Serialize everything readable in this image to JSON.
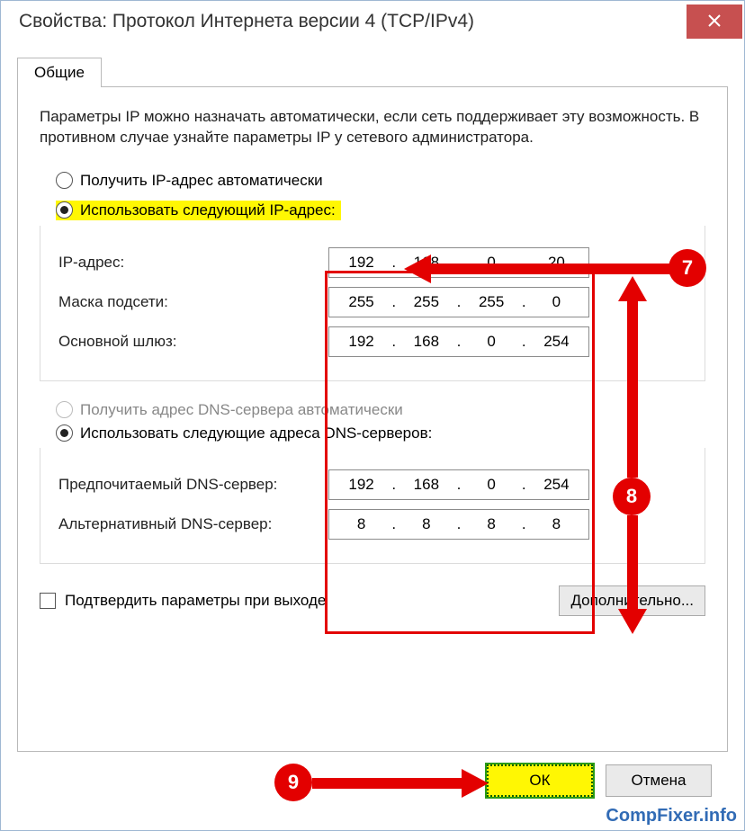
{
  "window": {
    "title": "Свойства: Протокол Интернета версии 4 (TCP/IPv4)"
  },
  "tab": {
    "label": "Общие"
  },
  "description": "Параметры IP можно назначать автоматически, если сеть поддерживает эту возможность. В противном случае узнайте параметры IP у сетевого администратора.",
  "ip_section": {
    "radio_auto": "Получить IP-адрес автоматически",
    "radio_manual": "Использовать следующий IP-адрес:",
    "fields": {
      "ip_label": "IP-адрес:",
      "ip": [
        "192",
        "168",
        "0",
        "20"
      ],
      "mask_label": "Маска подсети:",
      "mask": [
        "255",
        "255",
        "255",
        "0"
      ],
      "gw_label": "Основной шлюз:",
      "gw": [
        "192",
        "168",
        "0",
        "254"
      ]
    }
  },
  "dns_section": {
    "radio_auto": "Получить адрес DNS-сервера автоматически",
    "radio_manual": "Использовать следующие адреса DNS-серверов:",
    "fields": {
      "pref_label": "Предпочитаемый DNS-сервер:",
      "pref": [
        "192",
        "168",
        "0",
        "254"
      ],
      "alt_label": "Альтернативный DNS-сервер:",
      "alt": [
        "8",
        "8",
        "8",
        "8"
      ]
    }
  },
  "confirm_checkbox": "Подтвердить параметры при выходе",
  "advanced_btn": "Дополнительно...",
  "buttons": {
    "ok": "ОК",
    "cancel": "Отмена"
  },
  "callouts": {
    "c7": "7",
    "c8": "8",
    "c9": "9"
  },
  "dot": ".",
  "watermark": "CompFixer.info"
}
